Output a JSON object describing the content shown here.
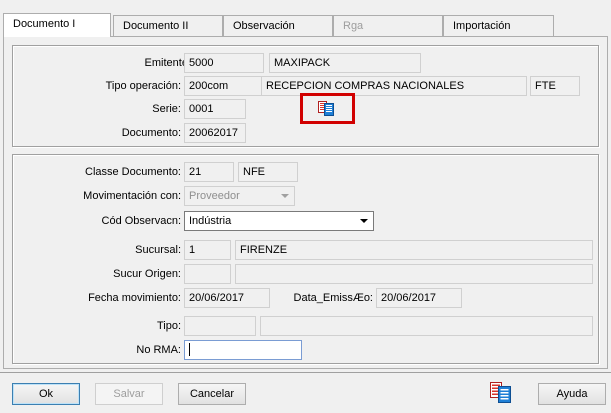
{
  "tabs": [
    {
      "label": "Documento  I",
      "state": "active"
    },
    {
      "label": "Documento II",
      "state": "normal"
    },
    {
      "label": "Observación",
      "state": "normal"
    },
    {
      "label": "Rga",
      "state": "disabled"
    },
    {
      "label": "Importación",
      "state": "normal"
    }
  ],
  "header_group": {
    "emitente_label": "Emitente:",
    "emitente_code": "5000",
    "emitente_name": "MAXIPACK",
    "tipo_operacion_label": "Tipo operación:",
    "tipo_operacion_code": "200com",
    "tipo_operacion_desc": "RECEPCION COMPRAS NACIONALES",
    "tipo_operacion_extra": "FTE",
    "serie_label": "Serie:",
    "serie_value": "0001",
    "serie_icon": "document-list-icon",
    "documento_label": "Documento:",
    "documento_value": "20062017"
  },
  "detail_group": {
    "classe_label": "Classe Documento:",
    "classe_code": "21",
    "classe_desc": "NFE",
    "movimentacion_label": "Movimentación con:",
    "movimentacion_value": "Proveedor",
    "cod_obs_label": "Cód Observacn:",
    "cod_obs_value": "Indústria",
    "sucursal_label": "Sucursal:",
    "sucursal_code": "1",
    "sucursal_name": "FIRENZE",
    "sucur_origen_label": "Sucur Origen:",
    "sucur_origen_code": "",
    "sucur_origen_name": "",
    "fecha_mov_label": "Fecha movimiento:",
    "fecha_mov_value": "20/06/2017",
    "data_emiss_label": "Data_EmissÆo:",
    "data_emiss_value": "20/06/2017",
    "tipo_label": "Tipo:",
    "tipo_code": "",
    "tipo_desc": "",
    "no_rma_label": "No RMA:",
    "no_rma_value": ""
  },
  "buttons": {
    "ok": "Ok",
    "salvar": "Salvar",
    "cancelar": "Cancelar",
    "ayuda": "Ayuda",
    "toolbar_icon": "document-list-icon"
  },
  "colors": {
    "highlight": "#d10000",
    "icon_red": "#d9342b",
    "icon_blue": "#1f7fd6"
  }
}
